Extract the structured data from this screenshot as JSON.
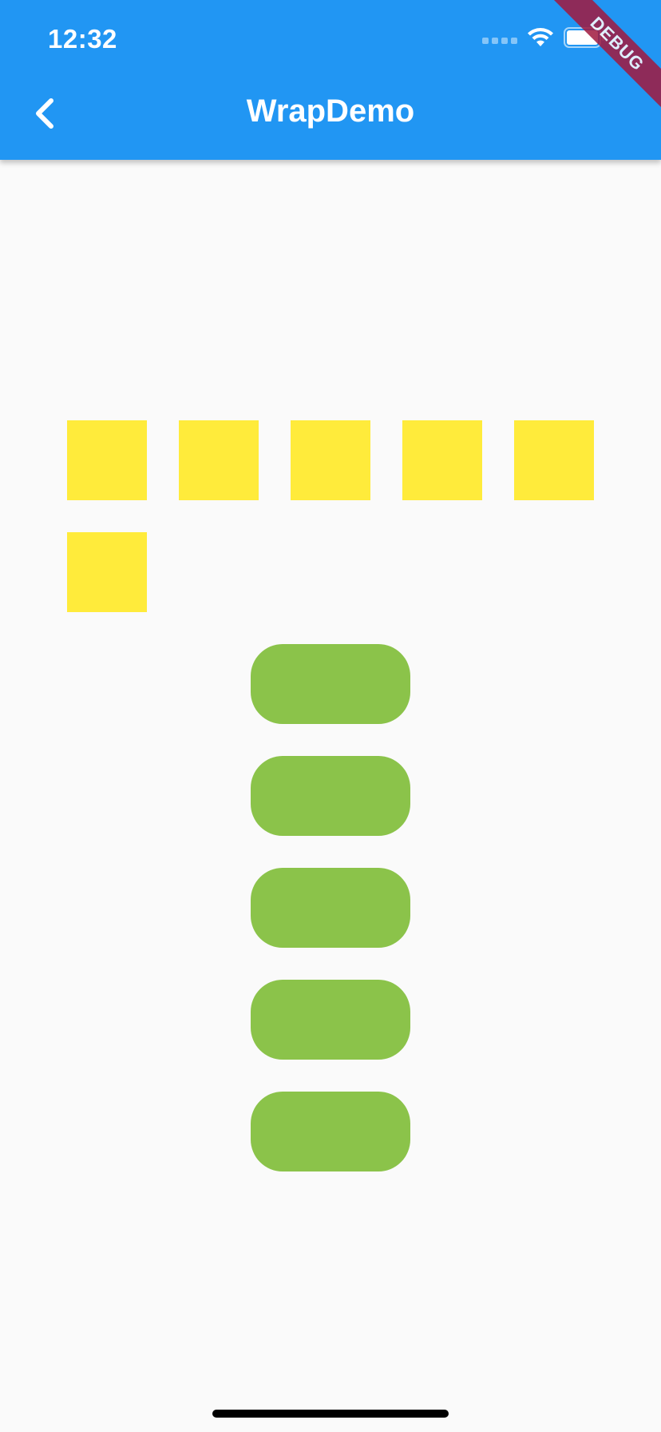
{
  "status_bar": {
    "time": "12:32",
    "wifi_icon": "wifi-icon",
    "battery_icon": "battery-icon"
  },
  "app_bar": {
    "title": "WrapDemo",
    "back_icon": "chevron-left-icon",
    "background_color": "#2196f3"
  },
  "debug_banner": {
    "label": "DEBUG",
    "color": "#a1193f"
  },
  "horizontal_wrap": {
    "item_count": 6,
    "item_color": "#ffeb3b"
  },
  "vertical_wrap": {
    "item_count": 5,
    "item_color": "#8bc34a"
  }
}
